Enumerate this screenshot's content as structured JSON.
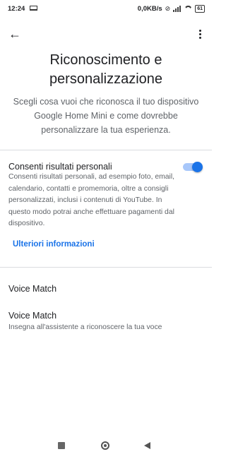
{
  "status": {
    "time": "12:24",
    "network_speed": "0,0KB/s",
    "battery": "61"
  },
  "header": {
    "title_line1": "Riconoscimento e",
    "title_line2": "personalizzazione",
    "subtitle": "Scegli cosa vuoi che riconosca il tuo dispositivo Google Home Mini e come dovrebbe personalizzare la tua esperienza."
  },
  "personal_results": {
    "title": "Consenti risultati personali",
    "description": "Consenti risultati personali, ad esempio foto, email, calendario, contatti e promemoria, oltre a consigli personalizzati, inclusi i contenuti di YouTube. In questo modo potrai anche effettuare pagamenti dal dispositivo.",
    "enabled": true,
    "learn_more": "Ulteriori informazioni"
  },
  "voice_match": {
    "section_title": "Voice Match",
    "item_title": "Voice Match",
    "item_subtitle": "Insegna all'assistente a riconoscere la tua voce"
  },
  "colors": {
    "accent": "#1a73e8",
    "toggle_track": "#a8c7fa"
  },
  "icons": {
    "back": "arrow-left-icon",
    "more": "more-vert-icon"
  }
}
